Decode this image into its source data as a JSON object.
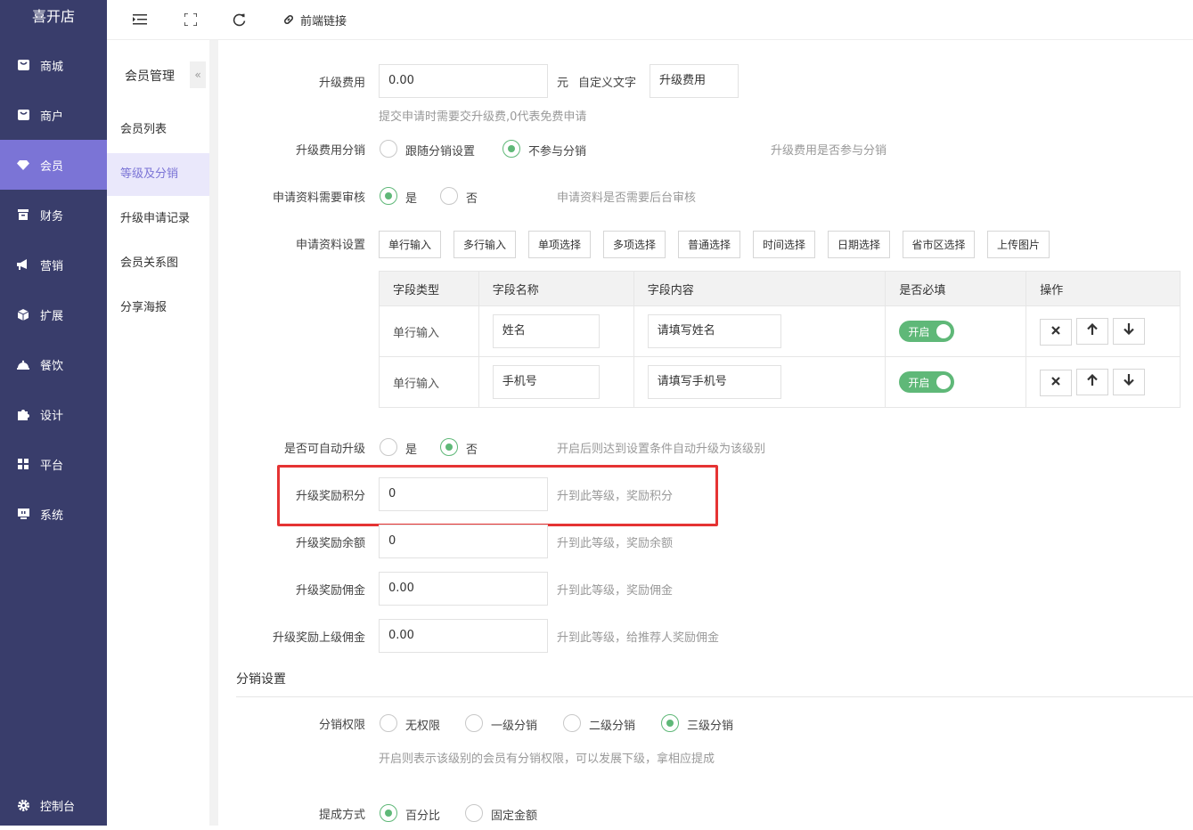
{
  "app": {
    "title": "喜开店"
  },
  "sidebar": {
    "items": [
      {
        "label": "商城",
        "icon": "store-icon"
      },
      {
        "label": "商户",
        "icon": "merchant-icon"
      },
      {
        "label": "会员",
        "icon": "member-icon",
        "active": true
      },
      {
        "label": "财务",
        "icon": "finance-icon"
      },
      {
        "label": "营销",
        "icon": "megaphone-icon"
      },
      {
        "label": "扩展",
        "icon": "cube-icon"
      },
      {
        "label": "餐饮",
        "icon": "cloche-icon"
      },
      {
        "label": "设计",
        "icon": "puzzle-icon"
      },
      {
        "label": "平台",
        "icon": "grid-icon"
      },
      {
        "label": "系统",
        "icon": "monitor-icon"
      }
    ],
    "console": "控制台"
  },
  "topbar": {
    "frontend_link": "前端链接"
  },
  "subnav": {
    "title": "会员管理",
    "collapse": "«",
    "items": [
      "会员列表",
      "等级及分销",
      "升级申请记录",
      "会员关系图",
      "分享海报"
    ]
  },
  "form": {
    "upgrade_fee": {
      "label": "升级费用",
      "value": "0.00",
      "unit": "元",
      "custom_label": "自定义文字",
      "custom_value": "升级费用",
      "hint": "提交申请时需要交升级费,0代表免费申请"
    },
    "fee_distribution": {
      "label": "升级费用分销",
      "options": [
        "跟随分销设置",
        "不参与分销"
      ],
      "selected": 1,
      "hint": "升级费用是否参与分销"
    },
    "review": {
      "label": "申请资料需要审核",
      "options": [
        "是",
        "否"
      ],
      "selected": 0,
      "hint": "申请资料是否需要后台审核"
    },
    "apply_settings": {
      "label": "申请资料设置",
      "buttons": [
        "单行输入",
        "多行输入",
        "单项选择",
        "多项选择",
        "普通选择",
        "时间选择",
        "日期选择",
        "省市区选择",
        "上传图片"
      ]
    },
    "fields_table": {
      "headers": [
        "字段类型",
        "字段名称",
        "字段内容",
        "是否必填",
        "操作"
      ],
      "rows": [
        {
          "type": "单行输入",
          "name": "姓名",
          "content": "请填写姓名",
          "required": "开启"
        },
        {
          "type": "单行输入",
          "name": "手机号",
          "content": "请填写手机号",
          "required": "开启"
        }
      ]
    },
    "auto_upgrade": {
      "label": "是否可自动升级",
      "options": [
        "是",
        "否"
      ],
      "selected": 1,
      "hint": "开启后则达到设置条件自动升级为该级别"
    },
    "reward_points": {
      "label": "升级奖励积分",
      "value": "0",
      "hint": "升到此等级，奖励积分"
    },
    "reward_balance": {
      "label": "升级奖励余额",
      "value": "0",
      "hint": "升到此等级，奖励余额"
    },
    "reward_commission": {
      "label": "升级奖励佣金",
      "value": "0.00",
      "hint": "升到此等级，奖励佣金"
    },
    "reward_parent": {
      "label": "升级奖励上级佣金",
      "value": "0.00",
      "hint": "升到此等级，给推荐人奖励佣金"
    }
  },
  "distribution": {
    "section_title": "分销设置",
    "permission": {
      "label": "分销权限",
      "options": [
        "无权限",
        "一级分销",
        "二级分销",
        "三级分销"
      ],
      "selected": 3,
      "hint": "开启则表示该级别的会员有分销权限，可以发展下级，拿相应提成"
    },
    "commission_type": {
      "label": "提成方式",
      "options": [
        "百分比",
        "固定金额"
      ],
      "selected": 0
    }
  },
  "colors": {
    "sidebar": "#393d6b",
    "active": "#7b74d6",
    "accent": "#5fb878",
    "highlight": "#e53333"
  }
}
